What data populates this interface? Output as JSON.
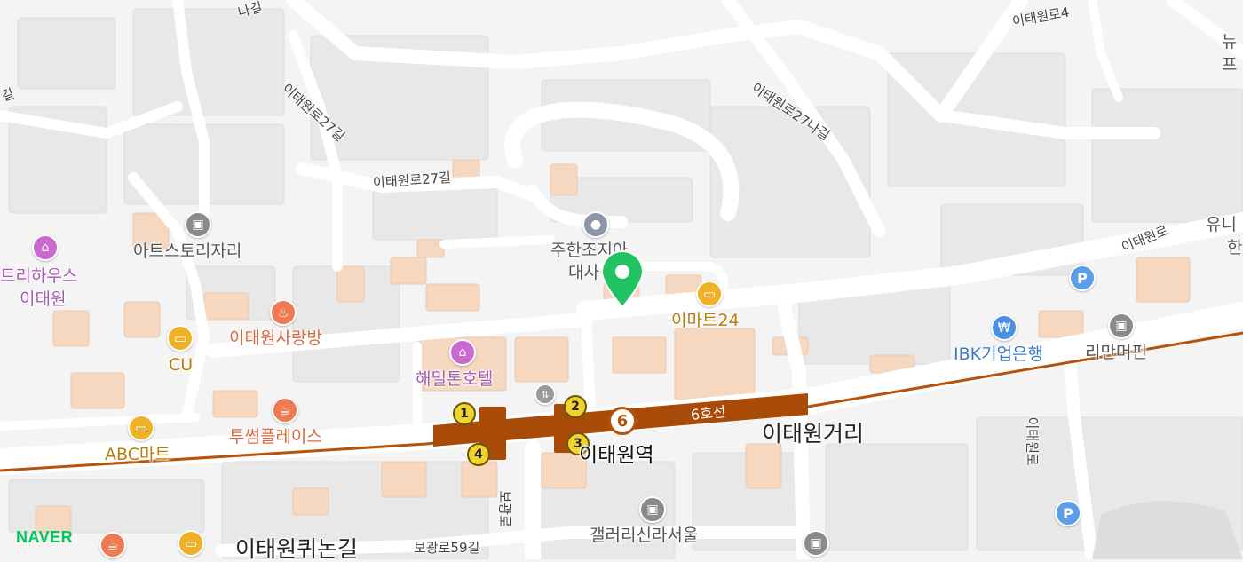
{
  "colors": {
    "background": "#f4f4f4",
    "road": "#ffffff",
    "building_gray": "#e6e6e6",
    "building_orange": "#f6d6bd",
    "subway_line": "#b5520b",
    "marker": "#21c262",
    "park_pin": "#5bb0ea",
    "hotel_pin": "#c96ad0",
    "food_pin": "#ee7a52",
    "shop_pin": "#f0b028",
    "gallery_pin": "#8b8b8b",
    "bank_pin": "#4a90e2"
  },
  "roads": {
    "r1": "이태원로27길",
    "r2": "이태원로27길",
    "r3": "이태원로27나길",
    "r4": "이태원로",
    "r5": "이태원로",
    "r6": "보광로",
    "r7": "보광로59길",
    "r8": "이태원로4",
    "r9": "나길",
    "r10": "길",
    "line6": "6호선",
    "line6_num": "6"
  },
  "places": {
    "artstory": "아트스토리자리",
    "treehouse_l1": "트리하우스",
    "treehouse_l2": "이태원",
    "sarangbang": "이태원사랑방",
    "cu": "CU",
    "hamilton": "해밀톤호텔",
    "twosome": "투썸플레이스",
    "abc": "ABC마트",
    "emart24": "이마트24",
    "embassy_l1": "주한조지아",
    "embassy_l2": "대사",
    "ibk": "IBK기업은행",
    "riman": "리만머핀",
    "itaewon_station": "이태원역",
    "itaewon_street": "이태원거리",
    "gallery_seoul": "갤러리신라서울",
    "queen_road": "이태원퀴논길",
    "newy_l1": "뉴",
    "newy_l2": "프",
    "uni_l1": "유니",
    "uni_l2": "한"
  },
  "exits": [
    "1",
    "2",
    "3",
    "4"
  ],
  "station_badge": "6",
  "icons": {
    "parking": "P",
    "bank": "₩"
  },
  "branding": "NAVER"
}
